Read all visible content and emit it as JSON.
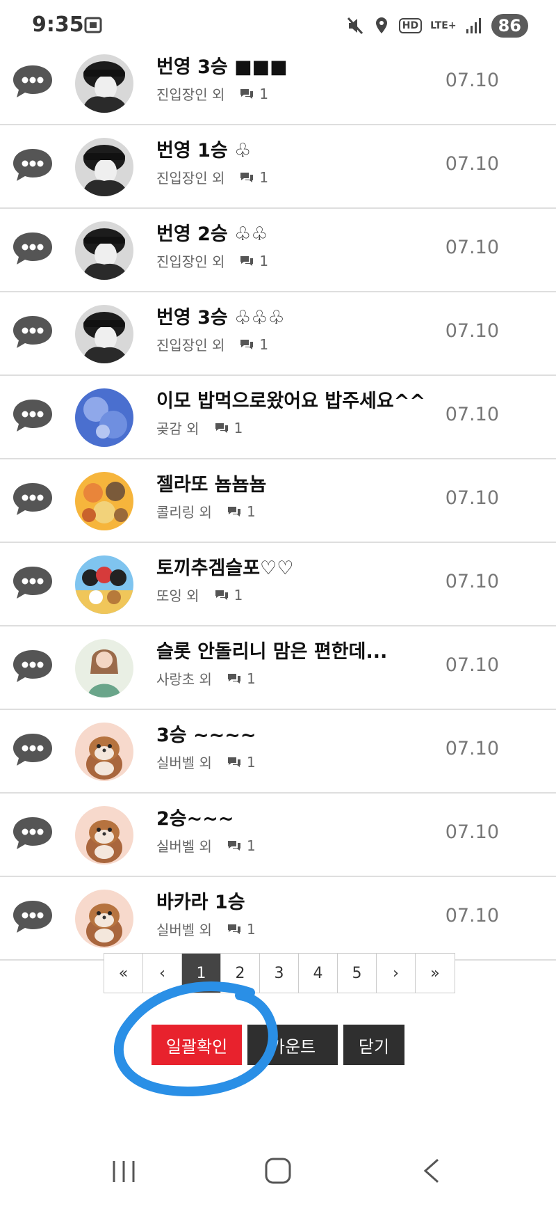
{
  "status_bar": {
    "time": "9:35",
    "hd": "HD",
    "network": "LTE+",
    "battery": "86",
    "icons": [
      "screenshot-icon",
      "mute-icon",
      "location-icon",
      "signal-icon"
    ]
  },
  "rows": [
    {
      "title": "번영 3승 ■■■",
      "author": "진입장인 외",
      "comments": "1",
      "date": "07.10",
      "avatar": "dark"
    },
    {
      "title": "번영 1승 ♧",
      "author": "진입장인 외",
      "comments": "1",
      "date": "07.10",
      "avatar": "dark"
    },
    {
      "title": "번영 2승 ♧♧",
      "author": "진입장인 외",
      "comments": "1",
      "date": "07.10",
      "avatar": "dark"
    },
    {
      "title": "번영 3승 ♧♧♧",
      "author": "진입장인 외",
      "comments": "1",
      "date": "07.10",
      "avatar": "dark"
    },
    {
      "title": "이모 밥먹으로왔어요 밥주세요^^",
      "author": "곶감 외",
      "comments": "1",
      "date": "07.10",
      "avatar": "blue"
    },
    {
      "title": "젤라또 뇸뇸뇸",
      "author": "콜리링 외",
      "comments": "1",
      "date": "07.10",
      "avatar": "cats"
    },
    {
      "title": "토끼추겜슬포♡♡",
      "author": "또잉 외",
      "comments": "1",
      "date": "07.10",
      "avatar": "penguins"
    },
    {
      "title": "슬롯 안돌리니 맘은 편한데...",
      "author": "사랑초 외",
      "comments": "1",
      "date": "07.10",
      "avatar": "girl"
    },
    {
      "title": "3승 ~~~~",
      "author": "실버벨 외",
      "comments": "1",
      "date": "07.10",
      "avatar": "otter"
    },
    {
      "title": "2승~~~",
      "author": "실버벨 외",
      "comments": "1",
      "date": "07.10",
      "avatar": "otter"
    },
    {
      "title": "바카라 1승",
      "author": "실버벨 외",
      "comments": "1",
      "date": "07.10",
      "avatar": "otter"
    }
  ],
  "pagination": {
    "first": "«",
    "prev": "‹",
    "pages": [
      "1",
      "2",
      "3",
      "4",
      "5"
    ],
    "active": "1",
    "next": "›",
    "last": "»"
  },
  "buttons": {
    "confirm_all": "일괄확인",
    "account": "카운트",
    "close": "닫기"
  },
  "colors": {
    "red": "#e8222d",
    "dark": "#2f2f2f",
    "annotation": "#2a8fe6"
  }
}
